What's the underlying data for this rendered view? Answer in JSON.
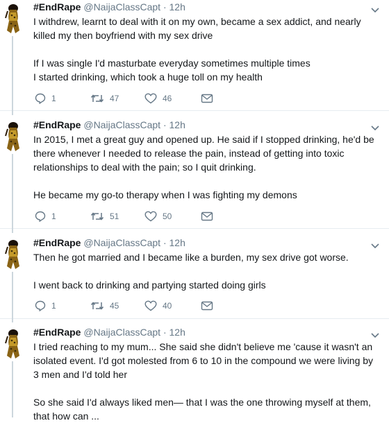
{
  "tweets": [
    {
      "name": "#EndRape",
      "handle": "@NaijaClassCapt",
      "dot": "·",
      "time": "12h",
      "paragraphs": [
        "I withdrew, learnt to deal with it on my own, became a sex addict, and nearly killed my then boyfriend with my sex drive",
        "If I was single I'd masturbate everyday sometimes multiple times I started drinking, which took a huge toll on my health"
      ],
      "replies": "1",
      "retweets": "47",
      "likes": "46"
    },
    {
      "name": "#EndRape",
      "handle": "@NaijaClassCapt",
      "dot": "·",
      "time": "12h",
      "paragraphs": [
        "In 2015, I met a great guy and opened up. He said if I stopped drinking, he'd be there whenever I needed to release the pain, instead of getting into toxic relationships to deal with the pain; so I quit drinking.",
        "He became my go-to therapy when I was fighting my demons"
      ],
      "replies": "1",
      "retweets": "51",
      "likes": "50"
    },
    {
      "name": "#EndRape",
      "handle": "@NaijaClassCapt",
      "dot": "·",
      "time": "12h",
      "paragraphs": [
        "Then he got married and I became like a burden, my sex drive got worse.",
        "I went back to drinking and partying started doing girls"
      ],
      "replies": "1",
      "retweets": "45",
      "likes": "40"
    },
    {
      "name": "#EndRape",
      "handle": "@NaijaClassCapt",
      "dot": "·",
      "time": "12h",
      "paragraphs": [
        "I tried reaching to my mum... She said she didn't believe me 'cause it wasn't an isolated event. I'd got molested from 6 to 10 in the compound we were living by 3 men and I'd told her",
        "So she said I'd always liked men— that I was the one throwing myself at them, that how can ..."
      ]
    }
  ],
  "icons": {
    "reply": "reply-icon",
    "retweet": "retweet-icon",
    "like": "heart-icon",
    "dm": "envelope-icon",
    "caret": "chevron-down-icon",
    "avatar": "avatar-image"
  },
  "colors": {
    "text": "#14171a",
    "secondary": "#657786",
    "thread_line": "#ccd6dd",
    "divider": "#e6ecf0"
  }
}
